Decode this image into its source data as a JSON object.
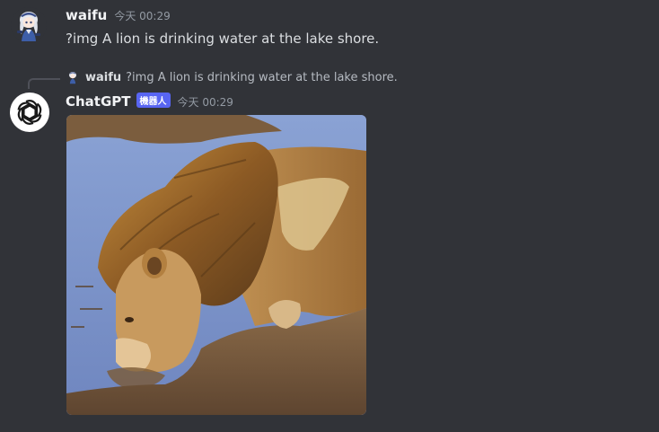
{
  "messages": [
    {
      "username": "waifu",
      "timestamp": "今天 00:29",
      "text": "?img A lion is drinking water at the lake shore.",
      "avatar_icon": "anime-girl-avatar-icon"
    },
    {
      "reply": {
        "username": "waifu",
        "text": "?img A lion is drinking water at the lake shore."
      },
      "username": "ChatGPT",
      "badge": "機器人",
      "timestamp": "今天 00:29",
      "avatar_icon": "openai-logo-icon",
      "attachment": {
        "kind": "image",
        "description_icon": "lion-drinking-image"
      }
    }
  ],
  "colors": {
    "background": "#313338",
    "username": "#f2f3f5",
    "text": "#dbdee1",
    "muted": "#949ba4",
    "bot_badge": "#5865f2"
  }
}
